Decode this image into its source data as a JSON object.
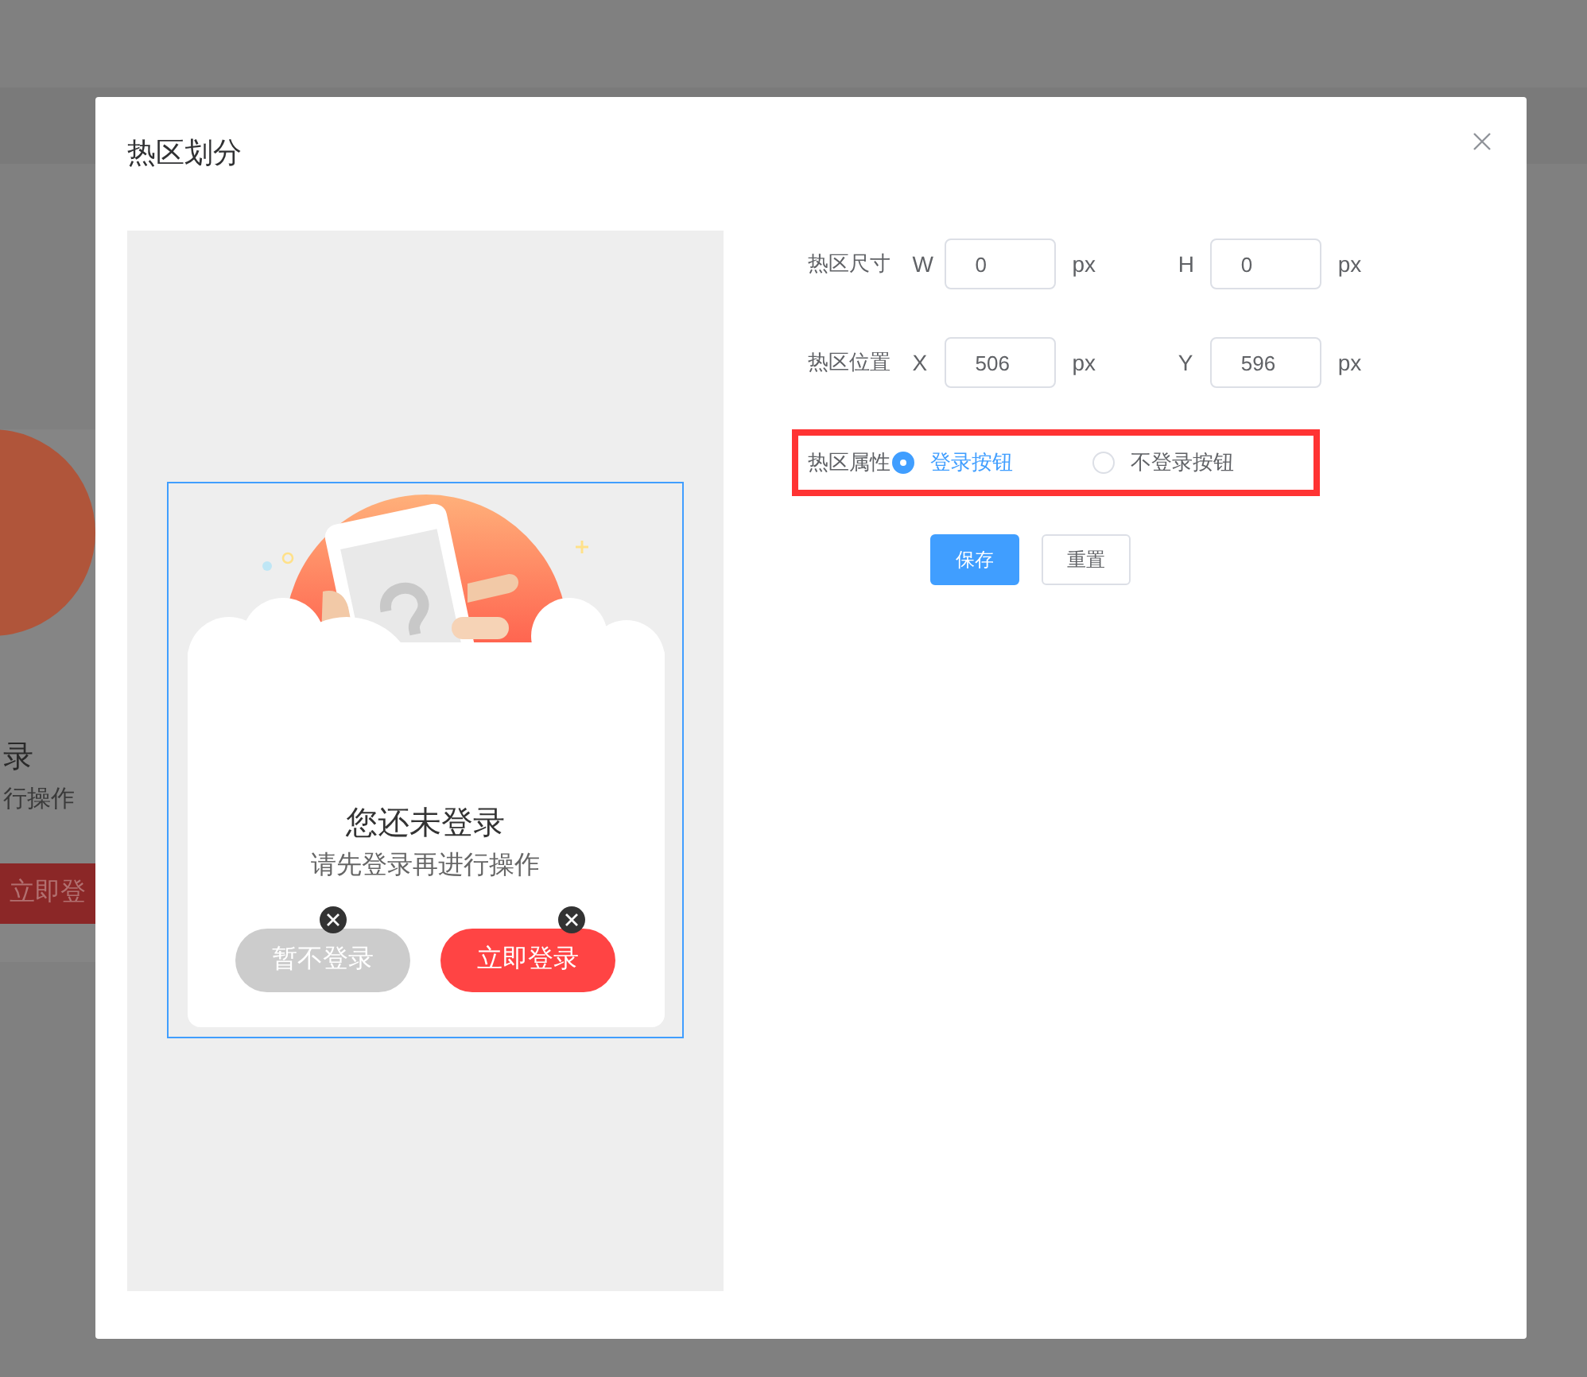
{
  "background_page": {
    "heading_fragment": "录",
    "subtitle_fragment": "行操作",
    "button_fragment": "立即登"
  },
  "dialog": {
    "title": "热区划分",
    "preview": {
      "heading": "您还未登录",
      "subtitle": "请先登录再进行操作",
      "buttons": [
        {
          "label": "暂不登录",
          "kind": "secondary"
        },
        {
          "label": "立即登录",
          "kind": "primary"
        }
      ]
    },
    "form": {
      "rows": [
        {
          "label": "热区尺寸",
          "fields": [
            {
              "axis": "W",
              "value": "0",
              "unit": "px"
            },
            {
              "axis": "H",
              "value": "0",
              "unit": "px"
            }
          ]
        },
        {
          "label": "热区位置",
          "fields": [
            {
              "axis": "X",
              "value": "506",
              "unit": "px"
            },
            {
              "axis": "Y",
              "value": "596",
              "unit": "px"
            }
          ]
        }
      ],
      "attribute": {
        "label": "热区属性",
        "highlighted": true,
        "options": [
          {
            "label": "登录按钮",
            "selected": true
          },
          {
            "label": "不登录按钮",
            "selected": false
          }
        ]
      },
      "buttons": [
        {
          "label": "保存",
          "kind": "primary"
        },
        {
          "label": "重置",
          "kind": "default"
        }
      ]
    }
  }
}
